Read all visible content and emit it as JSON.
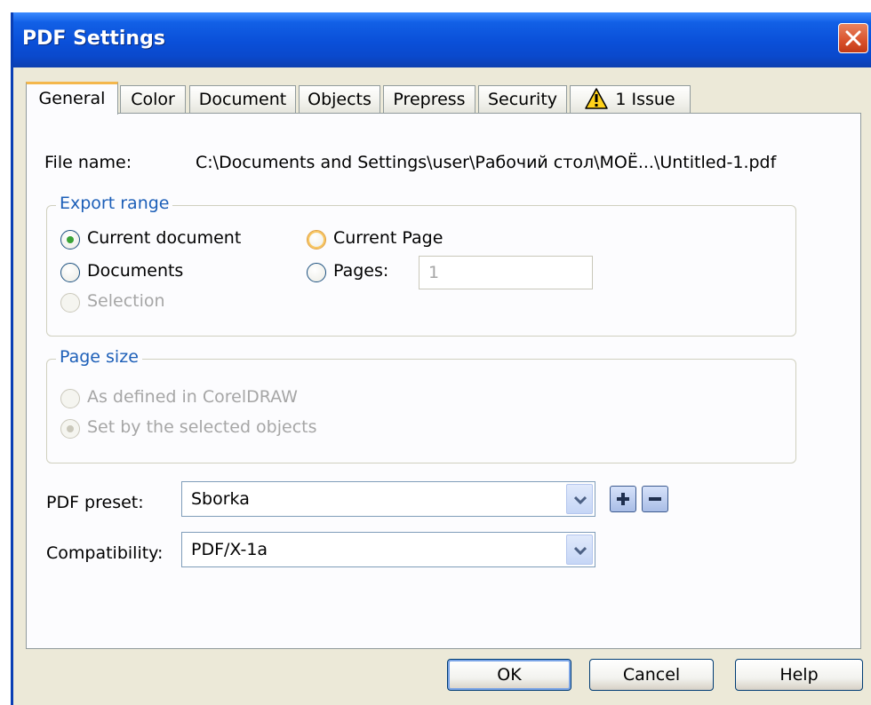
{
  "window": {
    "title": "PDF Settings"
  },
  "tabs": [
    {
      "label": "General",
      "active": true
    },
    {
      "label": "Color"
    },
    {
      "label": "Document"
    },
    {
      "label": "Objects"
    },
    {
      "label": "Prepress"
    },
    {
      "label": "Security"
    },
    {
      "label": "1 Issue",
      "icon": "warning-icon"
    }
  ],
  "general": {
    "file_name_label": "File name:",
    "file_name_value": "C:\\Documents and Settings\\user\\Рабочий стол\\МОЁ...\\Untitled-1.pdf",
    "export_range": {
      "legend": "Export range",
      "current_document": "Current document",
      "documents": "Documents",
      "selection": "Selection",
      "current_page": "Current Page",
      "pages": "Pages:",
      "pages_value": "1",
      "selected": "current_document"
    },
    "page_size": {
      "legend": "Page size",
      "as_defined": "As defined in CorelDRAW",
      "set_by_selected": "Set by the selected objects",
      "selected": "set_by_selected"
    },
    "pdf_preset_label": "PDF preset:",
    "pdf_preset_value": "Sborka",
    "compatibility_label": "Compatibility:",
    "compatibility_value": "PDF/X-1a"
  },
  "buttons": {
    "ok": "OK",
    "cancel": "Cancel",
    "help": "Help"
  },
  "colors": {
    "title_bar": "#0a4fd8",
    "accent_tab": "#f4b74c",
    "legend_text": "#1d5fb8",
    "radio_check": "#3aa337"
  }
}
